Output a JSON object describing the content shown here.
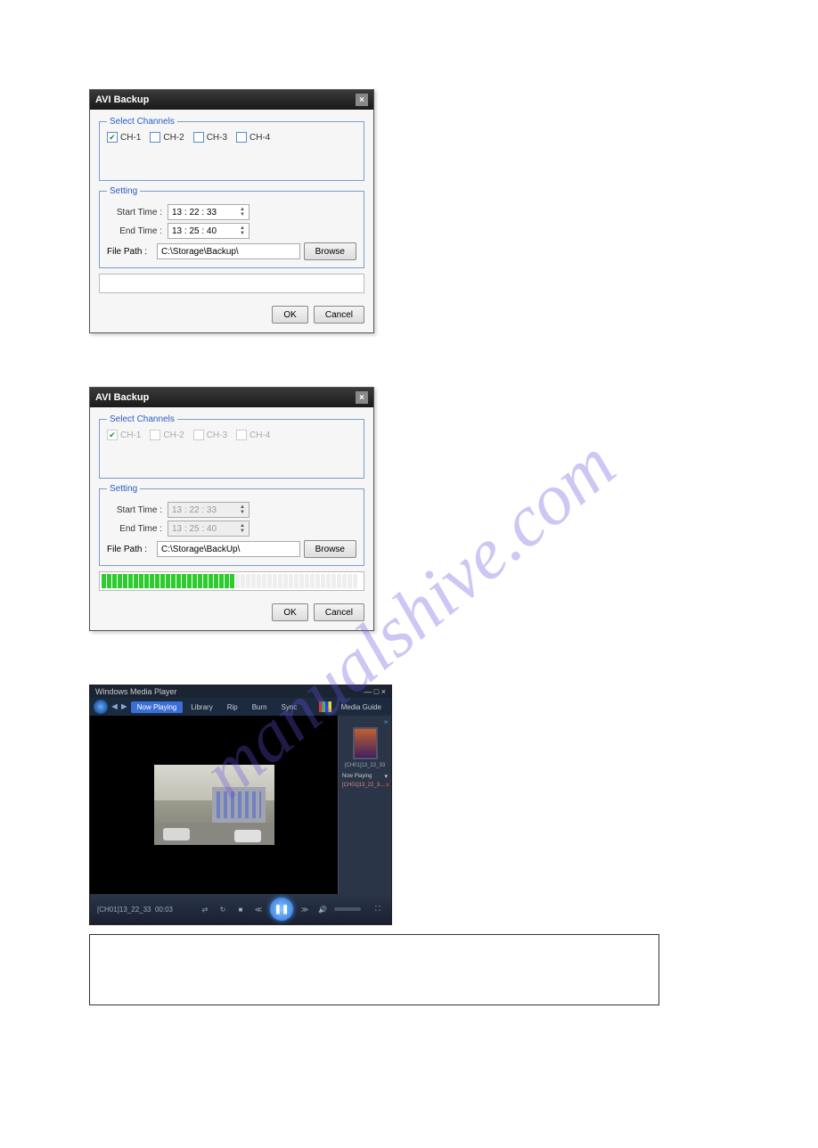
{
  "watermark": "manualshive.com",
  "dialog1": {
    "title": "AVI Backup",
    "channels_legend": "Select Channels",
    "ch1": "CH-1",
    "ch2": "CH-2",
    "ch3": "CH-3",
    "ch4": "CH-4",
    "setting_legend": "Setting",
    "start_label": "Start Time :",
    "end_label": "End Time :",
    "start_time": "13 : 22 : 33",
    "end_time": "13 : 25 : 40",
    "path_label": "File Path :",
    "path_value": "C:\\Storage\\Backup\\",
    "browse": "Browse",
    "ok": "OK",
    "cancel": "Cancel"
  },
  "dialog2": {
    "title": "AVI Backup",
    "channels_legend": "Select Channels",
    "ch1": "CH-1",
    "ch2": "CH-2",
    "ch3": "CH-3",
    "ch4": "CH-4",
    "setting_legend": "Setting",
    "start_label": "Start Time :",
    "end_label": "End Time :",
    "start_time": "13 : 22 : 33",
    "end_time": "13 : 25 : 40",
    "path_label": "File Path :",
    "path_value": "C:\\Storage\\BackUp\\",
    "browse": "Browse",
    "ok": "OK",
    "cancel": "Cancel",
    "progress_pct": 52
  },
  "wmp": {
    "app_title": "Windows Media Player",
    "tabs": {
      "now": "Now Playing",
      "lib": "Library",
      "rip": "Rip",
      "burn": "Burn",
      "sync": "Sync",
      "guide": "Media Guide"
    },
    "playlist_title": "[CH01]13_22_33",
    "now_playing_label": "Now Playing",
    "playlist_item": "[CH01]13_22_3…",
    "status_file": "[CH01]13_22_33",
    "status_time": "00:03"
  }
}
